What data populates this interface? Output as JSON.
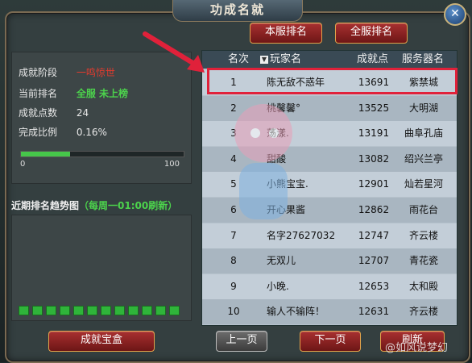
{
  "window": {
    "title": "功成名就",
    "close": "✕"
  },
  "tabs": {
    "server_rank": "本服排名",
    "all_rank": "全服排名"
  },
  "stats": {
    "stage_label": "成就阶段",
    "stage_value": "一鸣惊世",
    "rank_label": "当前排名",
    "rank_value": "全服 未上榜",
    "points_label": "成就点数",
    "points_value": "24",
    "pct_label": "完成比例",
    "pct_value": "0.16%",
    "progress_fraction": 0.3,
    "progress_min": "0",
    "progress_max": "100"
  },
  "trend": {
    "title": "近期排名趋势图",
    "note": "（每周一01:00刷新）",
    "bars": 12
  },
  "buttons": {
    "box": "成就宝盒",
    "prev": "上一页",
    "next": "下一页",
    "refresh": "刷新"
  },
  "table": {
    "headers": {
      "rank": "名次",
      "name": "玩家名",
      "score": "成就点",
      "server": "服务器名"
    },
    "rows": [
      {
        "rank": "1",
        "name": "陈无敌不惑年",
        "score": "13691",
        "server": "紫禁城"
      },
      {
        "rank": "2",
        "name": "桃馨馨°",
        "score": "13525",
        "server": "大明湖"
      },
      {
        "rank": "3",
        "name": "荡漾.",
        "score": "13191",
        "server": "曲阜孔庙"
      },
      {
        "rank": "4",
        "name": "甜酸",
        "score": "13082",
        "server": "绍兴兰亭"
      },
      {
        "rank": "5",
        "name": "小熊宝宝.",
        "score": "12901",
        "server": "灿若星河"
      },
      {
        "rank": "6",
        "name": "开心果酱",
        "score": "12862",
        "server": "雨花台"
      },
      {
        "rank": "7",
        "name": "名字27627032",
        "score": "12747",
        "server": "齐云楼"
      },
      {
        "rank": "8",
        "name": "无双儿",
        "score": "12707",
        "server": "青花瓷"
      },
      {
        "rank": "9",
        "name": "小晚.",
        "score": "12653",
        "server": "太和殿"
      },
      {
        "rank": "10",
        "name": "输人不输阵！",
        "score": "12631",
        "server": "齐云楼"
      }
    ]
  },
  "watermark": "@如风说梦幻",
  "colors": {
    "highlight": "#e0213a",
    "red_text": "#e23b2e",
    "green_text": "#4cd34c"
  }
}
